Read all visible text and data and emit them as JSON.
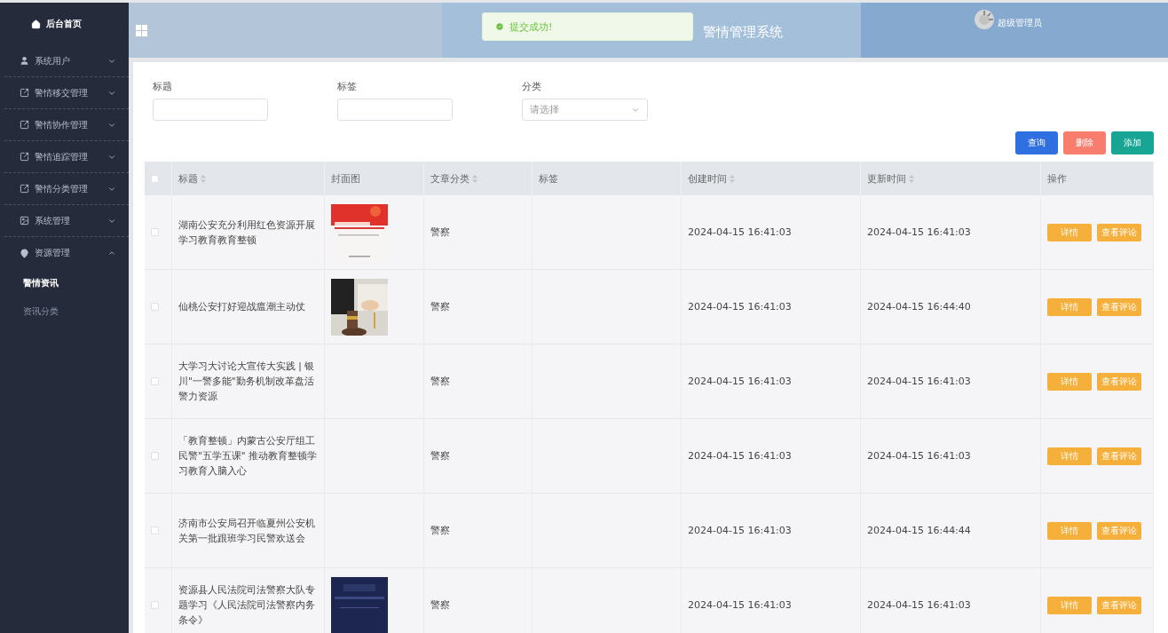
{
  "sidebar": {
    "home": "后台首页",
    "items": [
      {
        "label": "系统用户",
        "expanded": false
      },
      {
        "label": "警情移交管理",
        "expanded": false
      },
      {
        "label": "警情协作管理",
        "expanded": false
      },
      {
        "label": "警情追踪管理",
        "expanded": false
      },
      {
        "label": "警情分类管理",
        "expanded": false
      },
      {
        "label": "系统管理",
        "expanded": false
      },
      {
        "label": "资源管理",
        "expanded": true,
        "children": [
          {
            "label": "警情资讯",
            "selected": true
          },
          {
            "label": "资讯分类",
            "selected": false
          }
        ]
      }
    ]
  },
  "header": {
    "title": "警情管理系统",
    "user": "超级管理员"
  },
  "toast": {
    "message": "提交成功!"
  },
  "filters": [
    {
      "kind": "input",
      "label": "标题"
    },
    {
      "kind": "input",
      "label": "标签"
    },
    {
      "kind": "select",
      "label": "分类",
      "placeholder": "请选择"
    }
  ],
  "actions": [
    {
      "label": "查询",
      "kind": "primary"
    },
    {
      "label": "删除",
      "kind": "danger"
    },
    {
      "label": "添加",
      "kind": "success"
    }
  ],
  "table": {
    "all_checked": false,
    "columns": [
      {
        "label": "标题",
        "sortable": true
      },
      {
        "label": "封面图",
        "sortable": false
      },
      {
        "label": "文章分类",
        "sortable": true
      },
      {
        "label": "标签",
        "sortable": false
      },
      {
        "label": "创建时间",
        "sortable": true
      },
      {
        "label": "更新时间",
        "sortable": true
      },
      {
        "label": "操作",
        "sortable": false
      }
    ],
    "rows": [
      {
        "checked": false,
        "title": "湖南公安充分利用红色资源开展学习教育教育整顿",
        "cover": {
          "kind": "picture"
        },
        "category": "警察",
        "created": "2024-04-15 16:41:03",
        "updated": "2024-04-15 16:41:03",
        "buttons": [
          "详情",
          "查看评论"
        ]
      },
      {
        "checked": false,
        "title": "仙桃公安打好迎战瘟潮主动仗",
        "cover": {
          "kind": "picture"
        },
        "category": "警察",
        "created": "2024-04-15 16:41:03",
        "updated": "2024-04-15 16:44:40",
        "buttons": [
          "详情",
          "查看评论"
        ]
      },
      {
        "checked": false,
        "title": "大学习大讨论大宣传大实践 | 银川\"一警多能\"勤务机制改革盘活警力资源",
        "category": "警察",
        "created": "2024-04-15 16:41:03",
        "updated": "2024-04-15 16:41:03",
        "buttons": [
          "详情",
          "查看评论"
        ]
      },
      {
        "checked": false,
        "title": "「教育整顿」内蒙古公安厅组工民警\"五学五课\" 推动教育整顿学习教育入脑入心",
        "category": "警察",
        "created": "2024-04-15 16:41:03",
        "updated": "2024-04-15 16:41:03",
        "buttons": [
          "详情",
          "查看评论"
        ]
      },
      {
        "checked": false,
        "title": "济南市公安局召开临夏州公安机关第一批跟班学习民警欢送会",
        "category": "警察",
        "created": "2024-04-15 16:41:03",
        "updated": "2024-04-15 16:44:44",
        "buttons": [
          "详情",
          "查看评论"
        ]
      },
      {
        "checked": false,
        "title": "资源县人民法院司法警察大队专题学习《人民法院司法警察内务条令》",
        "cover": {
          "kind": "picture"
        },
        "category": "警察",
        "created": "2024-04-15 16:41:03",
        "updated": "2024-04-15 16:41:03",
        "buttons": [
          "详情",
          "查看评论"
        ]
      }
    ]
  }
}
